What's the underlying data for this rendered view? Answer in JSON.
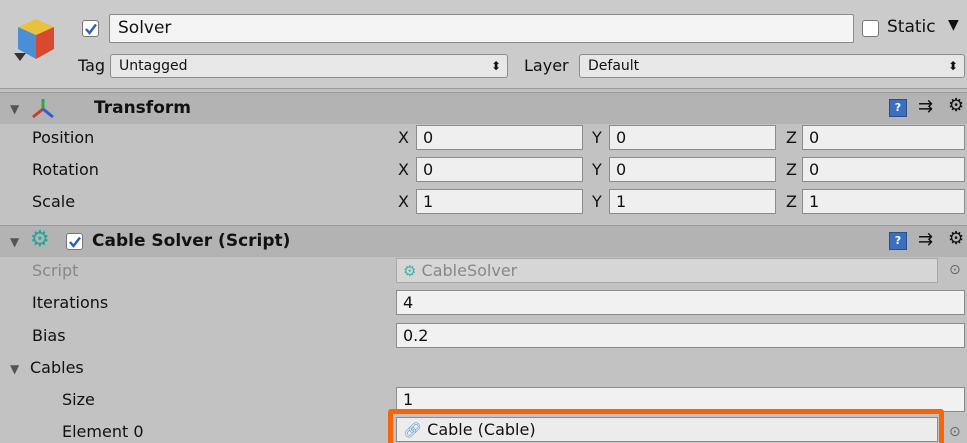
{
  "header": {
    "object_name": "Solver",
    "active_checked": true,
    "static_label": "Static",
    "static_arrow": "▼",
    "tag_label": "Tag",
    "tag_value": "Untagged",
    "layer_label": "Layer",
    "layer_value": "Default",
    "dropdown_arrow": "⬍"
  },
  "transform": {
    "title": "Transform",
    "rows": [
      {
        "label": "Position",
        "x": "0",
        "y": "0",
        "z": "0"
      },
      {
        "label": "Rotation",
        "x": "0",
        "y": "0",
        "z": "0"
      },
      {
        "label": "Scale",
        "x": "1",
        "y": "1",
        "z": "1"
      }
    ],
    "axis_x": "X",
    "axis_y": "Y",
    "axis_z": "Z"
  },
  "cable_solver": {
    "title": "Cable Solver (Script)",
    "enabled": true,
    "script_label": "Script",
    "script_value": "CableSolver",
    "iterations_label": "Iterations",
    "iterations_value": "4",
    "bias_label": "Bias",
    "bias_value": "0.2",
    "cables_label": "Cables",
    "size_label": "Size",
    "size_value": "1",
    "element_label": "Element 0",
    "element_value": "Cable (Cable)"
  },
  "icons": {
    "help": "?",
    "preset": "⇉",
    "gear": "⚙",
    "picker": "⊙",
    "foldout": "▼"
  },
  "colors": {
    "highlight": "#f5660a",
    "component_icon": "#1fa89a",
    "checkbox_tick": "#2b5fb4"
  }
}
